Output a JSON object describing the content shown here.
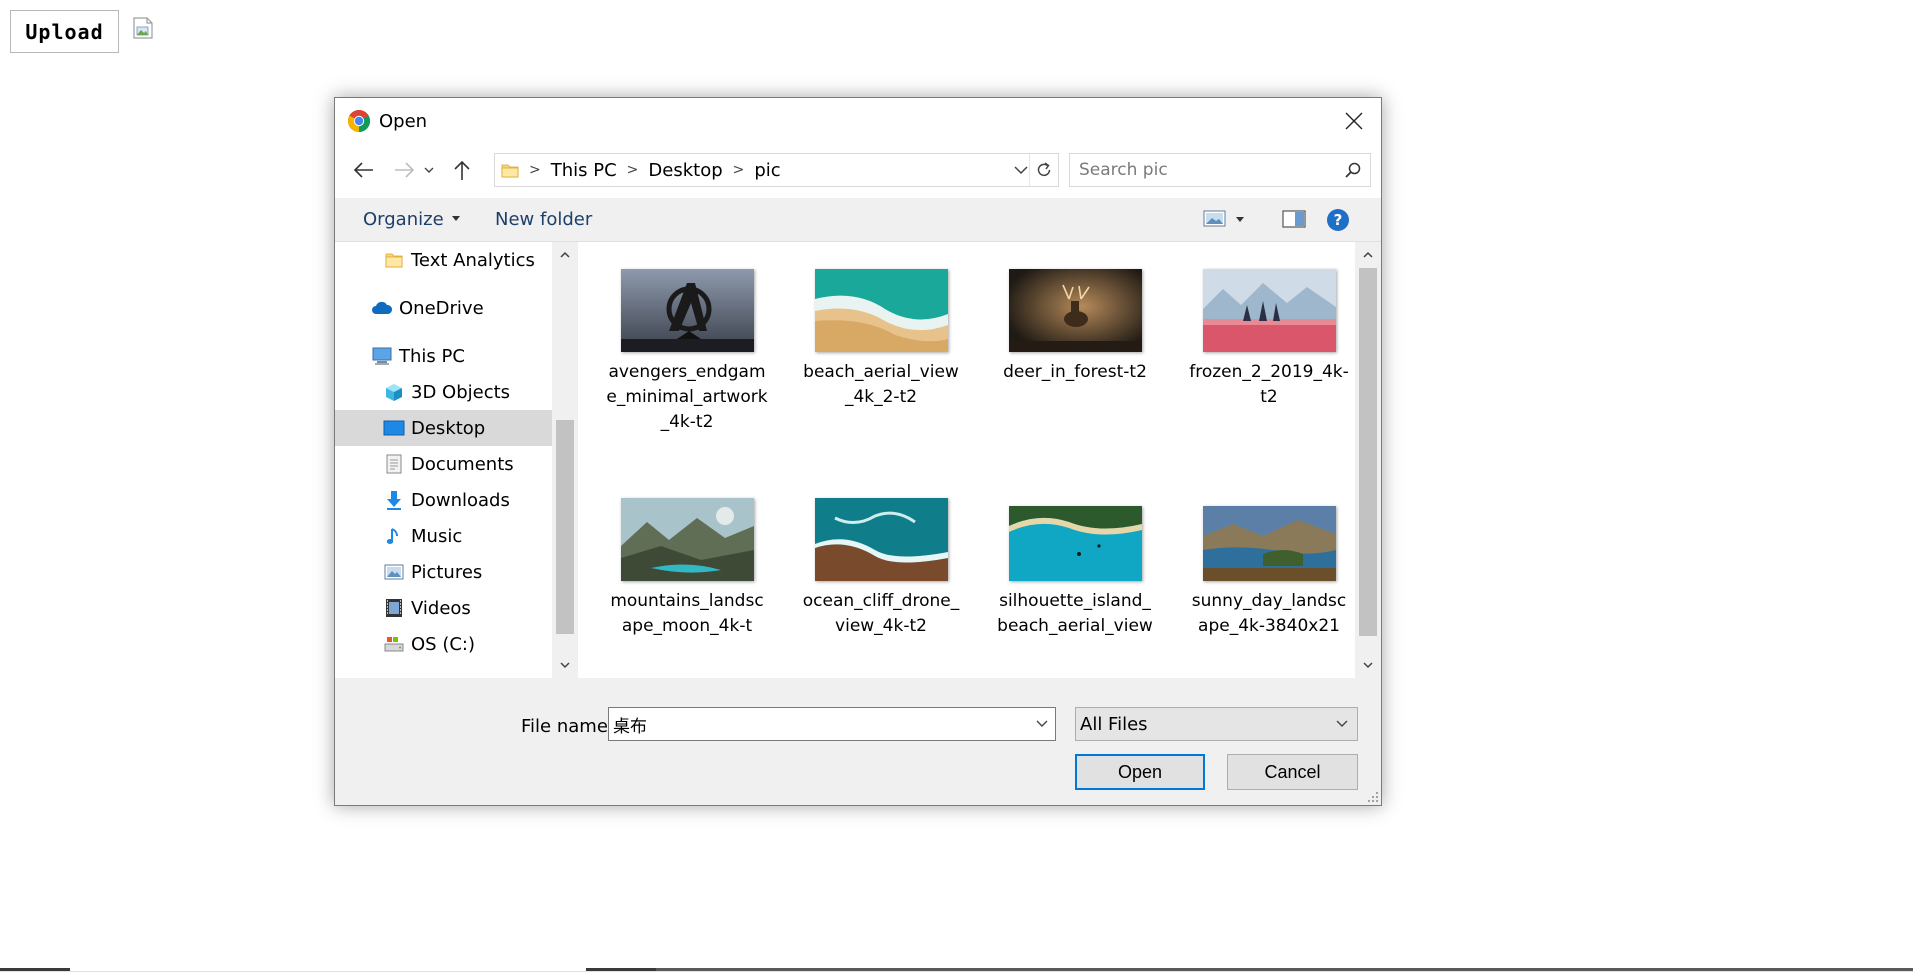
{
  "page": {
    "upload_label": "Upload"
  },
  "dialog": {
    "title": "Open",
    "breadcrumb": [
      "This PC",
      "Desktop",
      "pic"
    ],
    "search_placeholder": "Search pic",
    "commands": {
      "organize": "Organize",
      "new_folder": "New folder"
    },
    "nav_items": [
      {
        "label": "Text Analytics",
        "icon": "folder-icon"
      },
      {
        "label": "OneDrive",
        "icon": "cloud-icon"
      },
      {
        "label": "This PC",
        "icon": "computer-icon"
      },
      {
        "label": "3D Objects",
        "icon": "cube-icon"
      },
      {
        "label": "Desktop",
        "icon": "desktop-icon",
        "selected": true
      },
      {
        "label": "Documents",
        "icon": "document-icon"
      },
      {
        "label": "Downloads",
        "icon": "download-icon"
      },
      {
        "label": "Music",
        "icon": "music-icon"
      },
      {
        "label": "Pictures",
        "icon": "pictures-icon"
      },
      {
        "label": "Videos",
        "icon": "video-icon"
      },
      {
        "label": "OS (C:)",
        "icon": "drive-icon"
      }
    ],
    "files": [
      {
        "name": "avengers_endgame_minimal_artwork_4k-t2"
      },
      {
        "name": "beach_aerial_view_4k_2-t2"
      },
      {
        "name": "deer_in_forest-t2"
      },
      {
        "name": "frozen_2_2019_4k-t2"
      },
      {
        "name": "mountains_landscape_moon_4k-t"
      },
      {
        "name": "ocean_cliff_drone_view_4k-t2"
      },
      {
        "name": "silhouette_island_beach_aerial_view"
      },
      {
        "name": "sunny_day_landscape_4k-3840x21"
      }
    ],
    "file_name_label": "File name:",
    "file_name_value": "桌布",
    "file_type": "All Files",
    "open_label": "Open",
    "cancel_label": "Cancel"
  },
  "colors": {
    "accent": "#0078d7",
    "command_text": "#1e3f6a",
    "selected_bg": "#d9d9d9"
  }
}
